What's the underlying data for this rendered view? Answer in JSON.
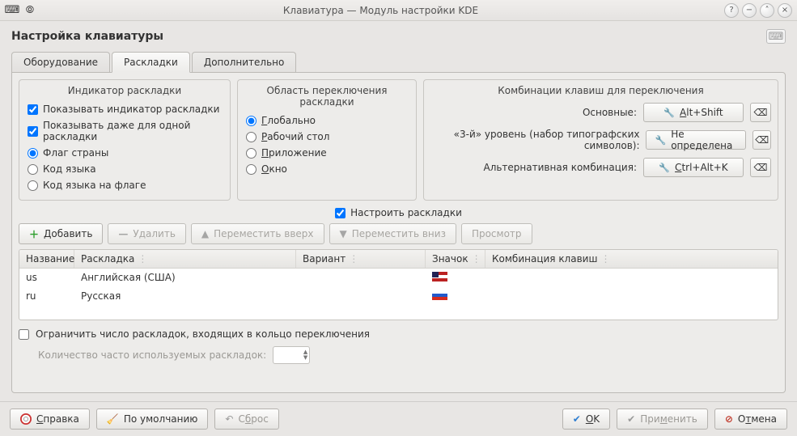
{
  "window": {
    "title": "Клавиатура — Модуль настройки KDE"
  },
  "header": {
    "title": "Настройка клавиатуры"
  },
  "tabs": [
    {
      "label": "Оборудование",
      "active": false
    },
    {
      "label": "Раскладки",
      "active": true
    },
    {
      "label": "Дополнительно",
      "active": false
    }
  ],
  "group_indicator": {
    "legend": "Индикатор раскладки",
    "show_indicator": {
      "label": "Показывать индикатор раскладки",
      "checked": true
    },
    "show_single": {
      "label": "Показывать даже для одной раскладки",
      "checked": true
    },
    "display_mode": {
      "flag": {
        "label": "Флаг страны"
      },
      "code": {
        "label": "Код языка"
      },
      "flagcode": {
        "label": "Код языка на флаге"
      },
      "selected": "flag"
    }
  },
  "group_switch": {
    "legend": "Область переключения раскладки",
    "options": {
      "global": {
        "label": "Глобально",
        "accel": "Г"
      },
      "desktop": {
        "label": "Рабочий стол",
        "accel": "Р"
      },
      "app": {
        "label": "Приложение",
        "accel": "П"
      },
      "window": {
        "label": "Окно",
        "accel": "О"
      }
    },
    "selected": "global"
  },
  "group_shortcuts": {
    "legend": "Комбинации клавиш для переключения",
    "rows": {
      "main": {
        "label": "Основные:",
        "value": "Alt+Shift",
        "accel": "A"
      },
      "level3": {
        "label": "«3-й» уровень (набор типографских символов):",
        "value": "Не определена"
      },
      "alt": {
        "label": "Альтернативная комбинация:",
        "value": "Ctrl+Alt+K",
        "accel": "C"
      }
    }
  },
  "configure_layouts": {
    "label": "Настроить раскладки",
    "checked": true
  },
  "toolbar": {
    "add": "Добавить",
    "remove": "Удалить",
    "up": "Переместить вверх",
    "down": "Переместить вниз",
    "preview": "Просмотр"
  },
  "table": {
    "headers": {
      "name": "Название",
      "layout": "Раскладка",
      "variant": "Вариант",
      "flag": "Значок",
      "shortcut": "Комбинация клавиш"
    },
    "rows": [
      {
        "name": "us",
        "layout": "Английская (США)",
        "variant": "",
        "flag": "us",
        "shortcut": ""
      },
      {
        "name": "ru",
        "layout": "Русская",
        "variant": "",
        "flag": "ru",
        "shortcut": ""
      }
    ]
  },
  "limit": {
    "label": "Ограничить число раскладок, входящих в кольцо переключения",
    "checked": false,
    "spin_label": "Количество часто используемых раскладок:"
  },
  "footer": {
    "help": "Справка",
    "defaults": "По умолчанию",
    "reset": "Сброс",
    "ok": "OK",
    "apply": "Применить",
    "cancel": "Отмена"
  }
}
